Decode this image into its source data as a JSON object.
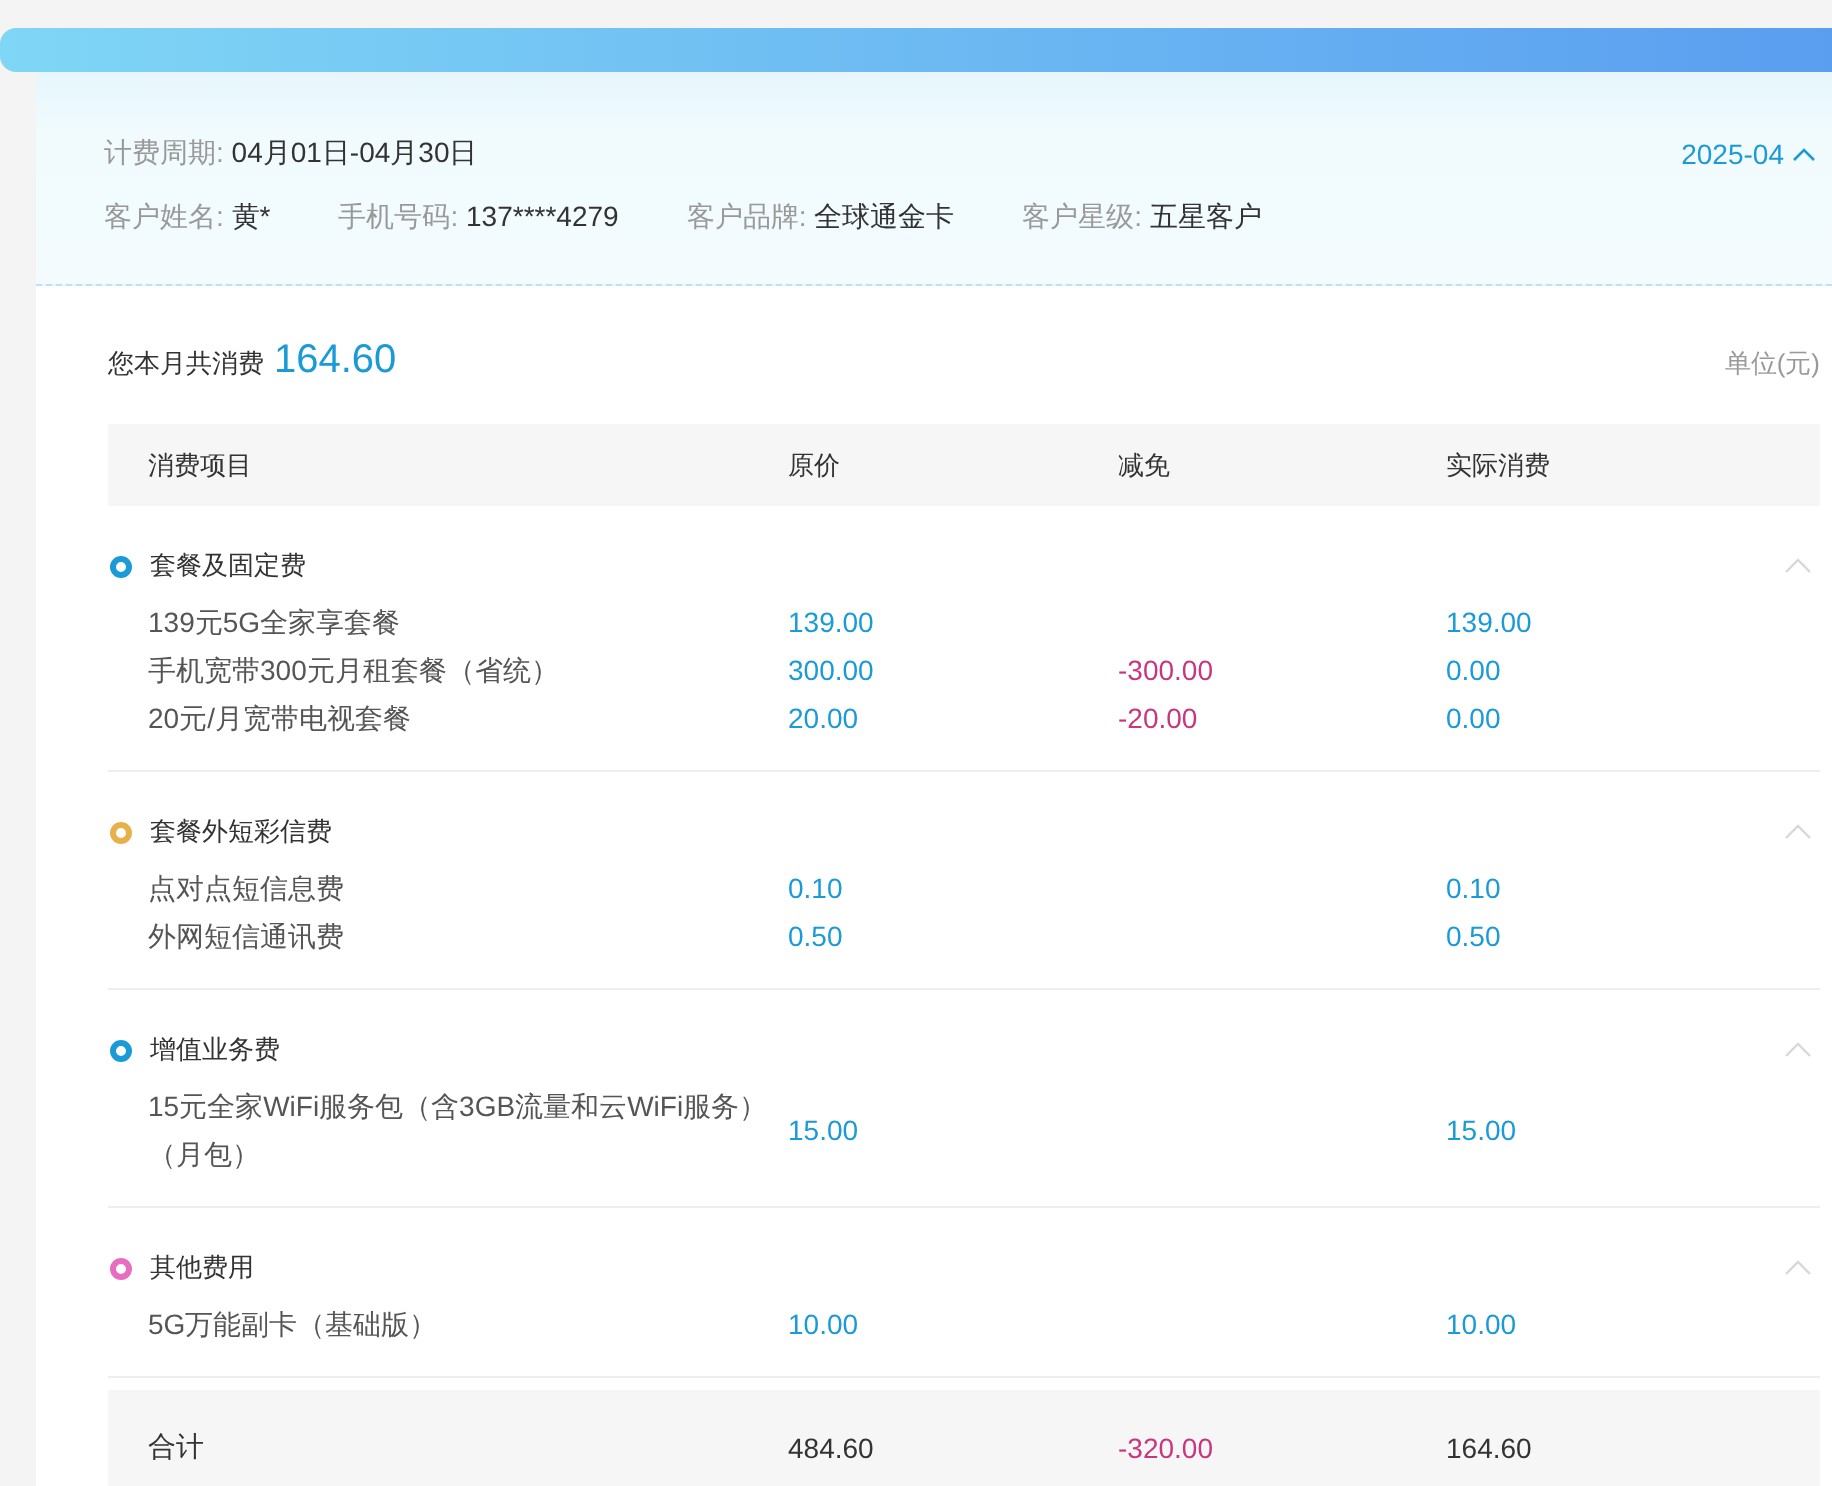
{
  "header": {
    "period_label": "计费周期:",
    "period": "04月01日-04月30日",
    "month": "2025-04",
    "month_expanded": true,
    "fields": [
      {
        "label": "客户姓名:",
        "value": "黄*"
      },
      {
        "label": "手机号码:",
        "value": "137****4279"
      },
      {
        "label": "客户品牌:",
        "value": "全球通金卡"
      },
      {
        "label": "客户星级:",
        "value": "五星客户"
      }
    ]
  },
  "summary": {
    "label": "您本月共消费",
    "total": "164.60",
    "unit": "单位(元)"
  },
  "table": {
    "columns": [
      "消费项目",
      "原价",
      "减免",
      "实际消费"
    ],
    "groups": [
      {
        "title": "套餐及固定费",
        "color": "#1a9ad6",
        "expanded": true,
        "rows": [
          {
            "item": "139元5G全家享套餐",
            "original": "139.00",
            "actual": "139.00"
          },
          {
            "item": "手机宽带300元月租套餐（省统）",
            "original": "300.00",
            "discount": "-300.00",
            "actual": "0.00"
          },
          {
            "item": "20元/月宽带电视套餐",
            "original": "20.00",
            "discount": "-20.00",
            "actual": "0.00"
          }
        ]
      },
      {
        "title": "套餐外短彩信费",
        "color": "#e8b04a",
        "expanded": true,
        "rows": [
          {
            "item": "点对点短信息费",
            "original": "0.10",
            "actual": "0.10"
          },
          {
            "item": "外网短信通讯费",
            "original": "0.50",
            "actual": "0.50"
          }
        ]
      },
      {
        "title": "增值业务费",
        "color": "#1a9ad6",
        "expanded": true,
        "rows": [
          {
            "item": "15元全家WiFi服务包（含3GB流量和云WiFi服务）（月包）",
            "original": "15.00",
            "actual": "15.00"
          }
        ]
      },
      {
        "title": "其他费用",
        "color": "#e86cc0",
        "expanded": true,
        "rows": [
          {
            "item": "5G万能副卡（基础版）",
            "original": "10.00",
            "actual": "10.00"
          }
        ]
      }
    ],
    "total": {
      "label": "合计",
      "original": "484.60",
      "discount": "-320.00",
      "actual": "164.60"
    }
  }
}
